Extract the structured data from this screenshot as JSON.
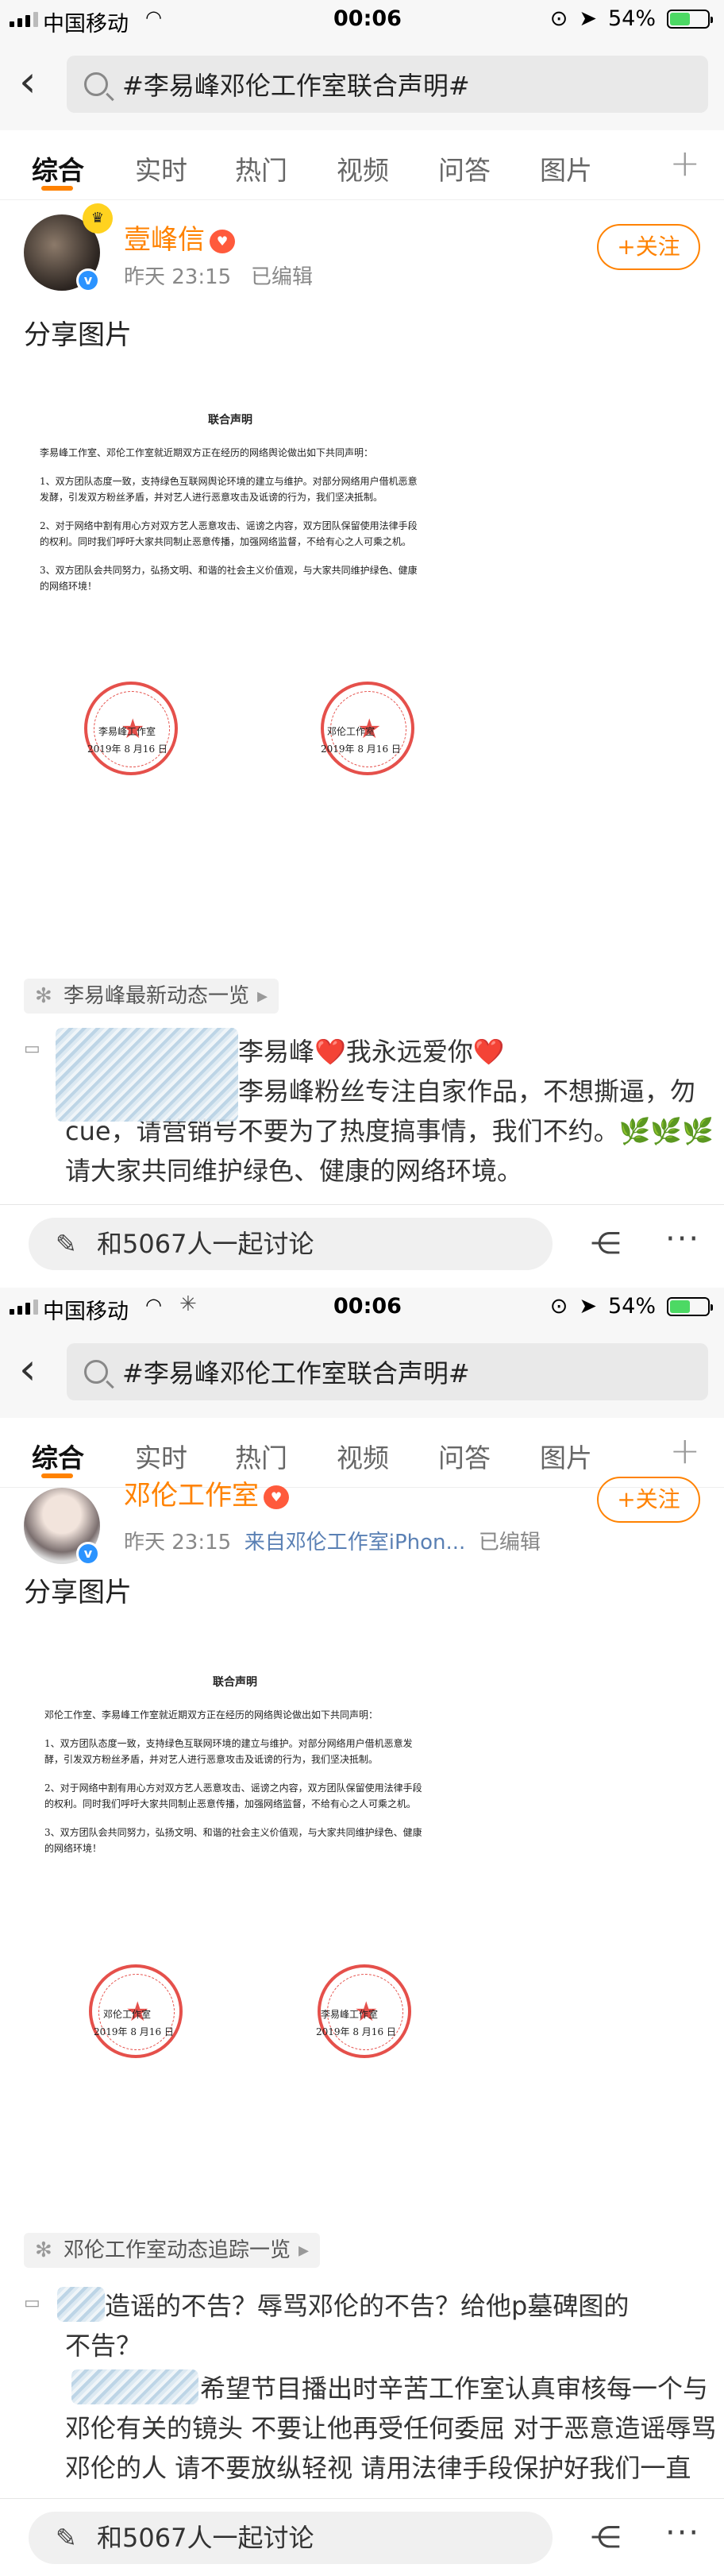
{
  "status": {
    "carrier": "中国移动",
    "time": "00:06",
    "battery": "54%",
    "battery_level": 0.54
  },
  "search": {
    "query": "#李易峰邓伦工作室联合声明#"
  },
  "tabs": [
    "综合",
    "实时",
    "热门",
    "视频",
    "问答",
    "图片"
  ],
  "posts": [
    {
      "author": "壹峰信",
      "time": "昨天 23:15",
      "source": "",
      "edited": "已编辑",
      "follow": "+关注",
      "text": "分享图片",
      "doc": {
        "title": "联合声明",
        "intro": "李易峰工作室、邓伦工作室就近期双方正在经历的网络舆论做出如下共同声明：",
        "p1": "1、双方团队态度一致，支持绿色互联网舆论环境的建立与维护。对部分网络用户借机恶意发酵，引发双方粉丝矛盾，并对艺人进行恶意攻击及诋谤的行为，我们坚决抵制。",
        "p2": "2、对于网络中割有用心方对双方艺人恶意攻击、谣谤之内容，双方团队保留使用法律手段的权利。同时我们呼吁大家共同制止恶意传播，加强网络监督，不给有心之人可乘之机。",
        "p3": "3、双方团队会共同努力，弘扬文明、和谐的社会主义价值观，与大家共同维护绿色、健康的网络环境！",
        "sig_left": "李易峰工作室",
        "sig_right": "邓伦工作室",
        "date_left": "2019年 8 月16 日",
        "date_right": "2019年 8 月16 日"
      },
      "topic": "李易峰最新动态一览",
      "comment_lines": [
        "李易峰❤️我永远爱你❤️",
        "李易峰粉丝专注自家作品，不想撕逼，勿",
        "cue，请营销号不要为了热度搞事情，我们不约。🌿🌿🌿",
        "请大家共同维护绿色、健康的网络环境。"
      ],
      "discuss": "和5067人一起讨论"
    },
    {
      "author": "邓伦工作室",
      "time": "昨天 23:15",
      "source": "来自邓伦工作室iPhon...",
      "edited": "已编辑",
      "follow": "+关注",
      "text": "分享图片",
      "doc": {
        "title": "联合声明",
        "intro": "邓伦工作室、李易峰工作室就近期双方正在经历的网络舆论做出如下共同声明：",
        "p1": "1、双方团队态度一致，支持绿色互联网环境的建立与维护。对部分网络用户借机恶意发酵，引发双方粉丝矛盾，并对艺人进行恶意攻击及诋谤的行为，我们坚决抵制。",
        "p2": "2、对于网络中割有用心方对双方艺人恶意攻击、谣谤之内容，双方团队保留使用法律手段的权利。同时我们呼吁大家共同制止恶意传播，加强网络监督，不给有心之人可乘之机。",
        "p3": "3、双方团队会共同努力，弘扬文明、和谐的社会主义价值观，与大家共同维护绿色、健康的网络环境！",
        "sig_left": "邓伦工作室",
        "sig_right": "李易峰工作室",
        "date_left": "2019年 8 月16 日",
        "date_right": "2019年 8 月16 日"
      },
      "topic": "邓伦工作室动态追踪一览",
      "comment_lines": [
        "造谣的不告？辱骂邓伦的不告？给他p墓碑图的",
        "不告？",
        "希望节目播出时辛苦工作室认真审核每一个与",
        "邓伦有关的镜头 不要让他再受任何委屈 对于恶意造谣辱骂",
        "邓伦的人 请不要放纵轻视 请用法律手段保护好我们一直"
      ],
      "discuss": "和5067人一起讨论"
    }
  ]
}
